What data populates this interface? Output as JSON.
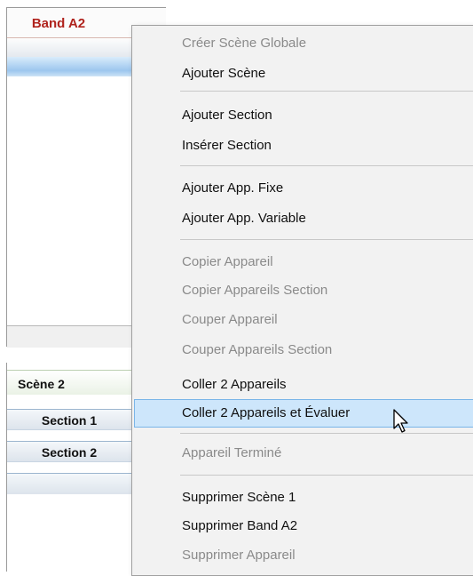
{
  "band": {
    "tab_label": "Band A2"
  },
  "scene": {
    "label": "Scène 2"
  },
  "sections": [
    {
      "label": "Section 1"
    },
    {
      "label": "Section 2"
    }
  ],
  "context_menu": {
    "items": [
      {
        "label": "Créer Scène Globale",
        "enabled": false
      },
      {
        "label": "Ajouter Scène",
        "enabled": true
      },
      {
        "label": "Ajouter Section",
        "enabled": true
      },
      {
        "label": "Insérer Section",
        "enabled": true
      },
      {
        "label": "Ajouter App. Fixe",
        "enabled": true
      },
      {
        "label": "Ajouter App. Variable",
        "enabled": true
      },
      {
        "label": "Copier Appareil",
        "enabled": false
      },
      {
        "label": "Copier Appareils Section",
        "enabled": false
      },
      {
        "label": "Couper Appareil",
        "enabled": false
      },
      {
        "label": "Couper Appareils Section",
        "enabled": false
      },
      {
        "label": "Coller 2 Appareils",
        "enabled": true
      },
      {
        "label": "Coller 2 Appareils et Évaluer",
        "enabled": true,
        "highlighted": true
      },
      {
        "label": "Appareil Terminé",
        "enabled": false
      },
      {
        "label": "Supprimer  Scène 1",
        "enabled": true
      },
      {
        "label": "Supprimer  Band A2",
        "enabled": true
      },
      {
        "label": "Supprimer Appareil",
        "enabled": false
      }
    ]
  },
  "colors": {
    "band_tab_text": "#b0231d",
    "menu_background": "#f2f2f2",
    "highlight_background": "#cde6fb",
    "highlight_border": "#7ab5e8",
    "disabled_text": "#8a8a8a"
  },
  "cursor": {
    "icon": "arrow-pointer-icon"
  }
}
